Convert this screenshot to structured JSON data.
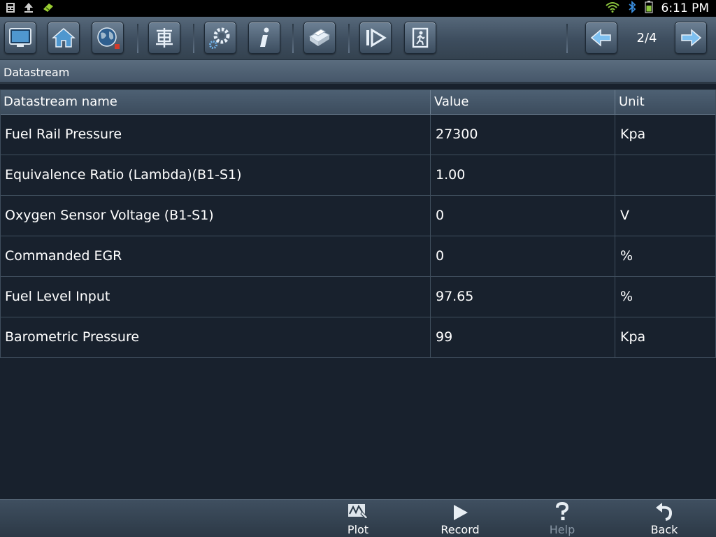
{
  "status_bar": {
    "time": "6:11 PM",
    "left_icons": [
      "notification-icon",
      "upload-icon",
      "android-debug-icon"
    ],
    "right_icons": [
      "wifi-icon",
      "bluetooth-icon",
      "battery-icon"
    ]
  },
  "toolbar": {
    "buttons": [
      "display-icon",
      "home-icon",
      "globe-icon",
      "vehicle-icon",
      "settings-icon",
      "info-icon",
      "print-icon",
      "play-icon",
      "exit-icon"
    ],
    "page_indicator": "2/4",
    "nav": [
      "arrow-left-icon",
      "arrow-right-icon"
    ]
  },
  "title": "Datastream",
  "table": {
    "headers": [
      "Datastream name",
      "Value",
      "Unit"
    ],
    "rows": [
      {
        "name": "Fuel Rail Pressure",
        "value": "27300",
        "unit": "Kpa"
      },
      {
        "name": "Equivalence Ratio (Lambda)(B1-S1)",
        "value": "1.00",
        "unit": ""
      },
      {
        "name": "Oxygen Sensor Voltage (B1-S1)",
        "value": "0",
        "unit": "V"
      },
      {
        "name": "Commanded EGR",
        "value": "0",
        "unit": "%"
      },
      {
        "name": "Fuel Level Input",
        "value": "97.65",
        "unit": "%"
      },
      {
        "name": "Barometric Pressure",
        "value": "99",
        "unit": "Kpa"
      }
    ]
  },
  "bottom_bar": {
    "plot_label": "Plot",
    "record_label": "Record",
    "help_label": "Help",
    "back_label": "Back"
  },
  "colors": {
    "background": "#18212d",
    "toolbar": "#46576a",
    "disabled_text": "#8896a4"
  }
}
